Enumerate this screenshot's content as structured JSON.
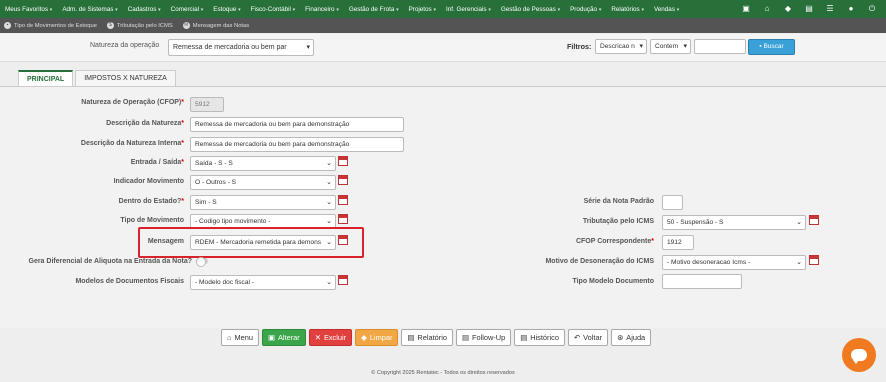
{
  "topmenu": [
    {
      "label": "Meus Favoritos"
    },
    {
      "label": "Adm. de Sistemas"
    },
    {
      "label": "Cadastros"
    },
    {
      "label": "Comercial"
    },
    {
      "label": "Estoque"
    },
    {
      "label": "Fisco-Contábil"
    },
    {
      "label": "Financeiro"
    },
    {
      "label": "Gestão de Frota"
    },
    {
      "label": "Projetos"
    },
    {
      "label": "Inf. Gerenciais"
    },
    {
      "label": "Gestão de Pessoas"
    },
    {
      "label": "Produção"
    },
    {
      "label": "Relatórios"
    },
    {
      "label": "Vendas"
    }
  ],
  "subnav": [
    {
      "label": "Tipo de Movimentos de Estoque"
    },
    {
      "label": "Tributação pelo ICMS"
    },
    {
      "label": "Mensagem das Notas"
    }
  ],
  "filters": {
    "natureza_label": "Natureza da operação",
    "natureza_value": "Remessa de mercadoria ou bem par",
    "filtros_label": "Filtros:",
    "filter1": "Descricao n",
    "filter2": "Contem",
    "search_value": "",
    "search_button": "Buscar"
  },
  "tabs": [
    {
      "label": "PRINCIPAL"
    },
    {
      "label": "IMPOSTOS X NATUREZA"
    }
  ],
  "form": {
    "cfop_label": "Natureza de Operação (CFOP)",
    "cfop_value": "5912",
    "descricao_label": "Descrição da Natureza",
    "descricao_value": "Remessa de mercadoria ou bem para demonstração",
    "desc_interna_label": "Descrição da Natureza Interna",
    "desc_interna_value": "Remessa de mercadoria ou bem para demonstração",
    "entrada_label": "Entrada / Saída",
    "entrada_value": "Saída - S - S",
    "indicador_label": "Indicador Movimento",
    "indicador_value": "O - Outros - S",
    "dentro_label": "Dentro do Estado?",
    "dentro_value": "Sim - S",
    "tipo_mov_label": "Tipo de Movimento",
    "tipo_mov_value": "- Codigo tipo movimento -",
    "mensagem_label": "Mensagem",
    "mensagem_value": "RDEM - Mercadoria remetida para demons",
    "gera_dif_label": "Gera Diferencial de Aliquota na Entrada da Nota?",
    "modelos_label": "Modelos de Documentos Fiscais",
    "modelos_value": "- Modelo doc fiscal -",
    "serie_label": "Série da Nota Padrão",
    "serie_value": "",
    "tributacao_label": "Tributação pelo ICMS",
    "tributacao_value": "50 - Suspensão - S",
    "cfop_corr_label": "CFOP Correspondente",
    "cfop_corr_value": "1912",
    "motivo_label": "Motivo de Desoneração do ICMS",
    "motivo_value": "- Motivo desoneracao Icms -",
    "tipo_modelo_label": "Tipo Modelo Documento",
    "tipo_modelo_value": ""
  },
  "buttons": {
    "menu": "Menu",
    "alterar": "Alterar",
    "excluir": "Excluir",
    "limpar": "Limpar",
    "relatorio": "Relatório",
    "followup": "Follow-Up",
    "historico": "Histórico",
    "voltar": "Voltar",
    "ajuda": "Ajuda"
  },
  "footer": "© Copyright 2025 Rentatec - Todos os direitos reservados",
  "colors": {
    "topbar": "#27703a",
    "accent": "#3aa0d8",
    "highlight": "#d8232a",
    "chat": "#f07a20"
  }
}
